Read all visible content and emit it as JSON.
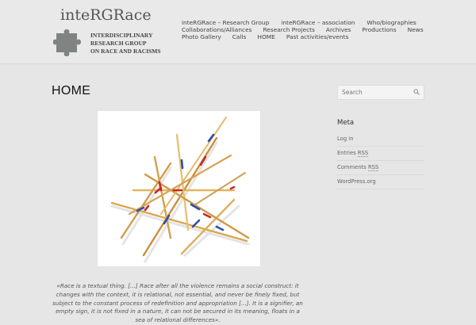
{
  "header": {
    "logo_title": "inteRGRace",
    "logo_subtitle": [
      "INTERDISCIPLINARY",
      "RESEARCH GROUP",
      "ON RACE AND RACISMS"
    ],
    "puzzle_icon_color": "#7f8482"
  },
  "nav": {
    "row1": [
      "inteRGRace – Research Group",
      "inteRGRace – association",
      "Who/biographies"
    ],
    "row2": [
      "Collaborations/Alliances",
      "Research Projects",
      "Archives",
      "Productions",
      "News"
    ],
    "row3": [
      "Photo Gallery",
      "Calls",
      "HOME",
      "Past activities/events"
    ]
  },
  "main": {
    "title": "HOME",
    "image_icon": "pick-up-sticks-image",
    "quote": "«Race is a textual thing. [...] Race after all the violence remains a social construct: it changes with the context, it is relational, not essential, and never be finely fixed, but subject to the constant process of redefinition and appropriation [...]. It is a signifier, an empty sign, it is not fixed in a nature, it can not be secured in its meaning, floats in a sea of relational differences»."
  },
  "sidebar": {
    "search_placeholder": "Search",
    "search_icon": "search-icon",
    "meta_title": "Meta",
    "meta_items": {
      "login": "Log in",
      "entries": "Entries",
      "comments": "Comments",
      "rss": "RSS",
      "wordpress": "WordPress.org"
    }
  },
  "colors": {
    "background": "#e6e6e6",
    "text": "#333333"
  }
}
